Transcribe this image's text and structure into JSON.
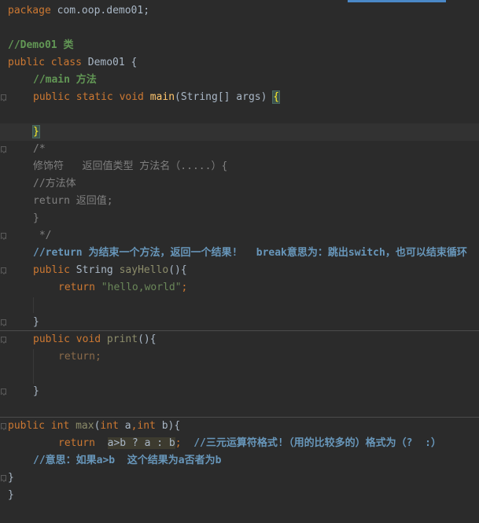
{
  "editor": {
    "language": "Java",
    "theme_colors": {
      "background": "#2b2b2b",
      "keyword": "#cc7832",
      "comment": "#629755",
      "string": "#6a8759",
      "method": "#ffc66d",
      "text": "#a9b7c6"
    },
    "lines": {
      "package_kw": "package",
      "package_name": " com.oop.demo01;",
      "cm_class": "//Demo01 类",
      "class_mods": "public class",
      "class_name": " Demo01 {",
      "cm_main": "//main 方法",
      "main_mods": "public static void",
      "main_name": "main",
      "main_params": "(String[] args) ",
      "main_open": "{",
      "main_close": "}",
      "blk_open": "/*",
      "blk_1": "修饰符   返回值类型 方法名（.....）{",
      "blk_2": "//方法体",
      "blk_3": "return 返回值;",
      "blk_4": "}",
      "blk_close": " */",
      "cm_return": "//return 为结束一个方法，返回一个结果!   break意思为：跳出switch，也可以结束循环",
      "say_mods": "public",
      "say_type": " String ",
      "say_name": "sayHello",
      "say_params": "(){",
      "say_ret_kw": "return ",
      "say_ret_str": "\"hello,world\"",
      "say_ret_end": ";",
      "say_close": "}",
      "print_mods": "public void",
      "print_name": " print",
      "print_params": "(){",
      "print_ret": "return;",
      "print_close": "}",
      "max_mods": "public int",
      "max_name": " max",
      "max_p1": "(",
      "max_int1": "int",
      "max_a": " a",
      "max_comma": ",",
      "max_int2": "int",
      "max_b": " b){",
      "max_ret_kw": "return",
      "max_ternary": "a>b ? a : b",
      "max_semicolon": ";",
      "max_cm": "//三元运算符格式!（用的比较多的）格式为（?  :）",
      "cm_meaning": "//意思：如果a>b  这个结果为a否者为b",
      "close1": "}",
      "close2": "}"
    }
  }
}
